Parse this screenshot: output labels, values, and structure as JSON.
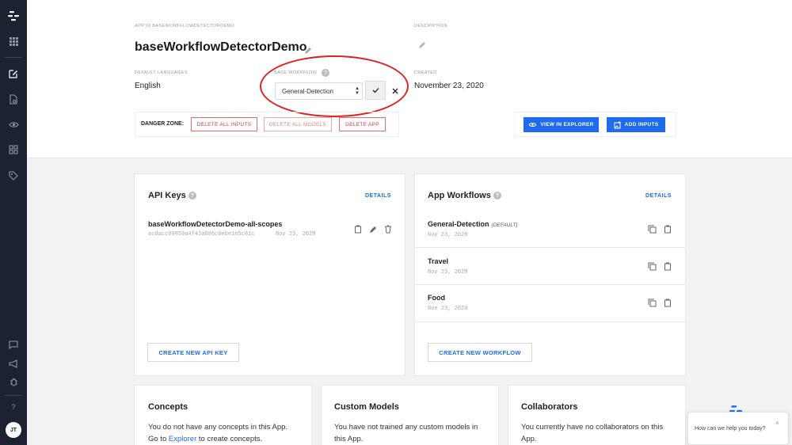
{
  "sidebar": {
    "avatar_initials": "JT",
    "icons": [
      "logo-icon",
      "grid-icon",
      "edit-icon",
      "document-search-icon",
      "eye-icon",
      "apps-icon",
      "tag-icon",
      "chat-icon",
      "megaphone-icon",
      "bug-icon",
      "help-icon"
    ]
  },
  "header": {
    "app_id_label": "APP ID baseWorkflowDetectorDemo",
    "app_name": "baseWorkflowDetectorDemo",
    "description_label": "DESCRIPTION",
    "default_languages_label": "DEFAULT LANGUAGES",
    "default_language": "English",
    "base_workflow_label": "BASE WORKFLOW",
    "base_workflow_value": "General-Detection",
    "created_label": "CREATED",
    "created_value": "November 23, 2020",
    "danger_zone_label": "DANGER ZONE:",
    "delete_all_inputs": "DELETE ALL INPUTS",
    "delete_all_models": "DELETE ALL MODELS",
    "delete_app": "DELETE APP",
    "view_in_explorer": "VIEW IN EXPLORER",
    "add_inputs": "ADD INPUTS"
  },
  "api_keys": {
    "title": "API Keys",
    "details": "DETAILS",
    "key_name": "baseWorkflowDetectorDemo-all-scopes",
    "key_value": "acdacc09859a4f43a086c6ebe1e5c81c",
    "key_date": "Nov 23, 2020",
    "create_button": "CREATE NEW API KEY"
  },
  "app_workflows": {
    "title": "App Workflows",
    "details": "DETAILS",
    "default_tag": "(DEFAULT)",
    "items": [
      {
        "name": "General-Detection",
        "date": "Nov 23, 2020"
      },
      {
        "name": "Travel",
        "date": "Nov 23, 2020"
      },
      {
        "name": "Food",
        "date": "Nov 23, 2020"
      }
    ],
    "create_button": "CREATE NEW WORKFLOW"
  },
  "concepts": {
    "title": "Concepts",
    "line1": "You do not have any concepts in this App.",
    "line2_pre": "Go to ",
    "line2_link": "Explorer",
    "line2_post": " to create concepts."
  },
  "custom_models": {
    "title": "Custom Models",
    "line1": "You have not trained any custom models in",
    "line2": "this App."
  },
  "collaborators": {
    "title": "Collaborators",
    "line1": "You currently have no collaborators on this",
    "line2": "App."
  },
  "chat": {
    "prompt": "How can we help you today?",
    "close": "×"
  },
  "colors": {
    "accent": "#1e6bf0",
    "danger": "#d04040",
    "sidebar": "#1d2230",
    "highlight_ellipse": "#e02020"
  }
}
